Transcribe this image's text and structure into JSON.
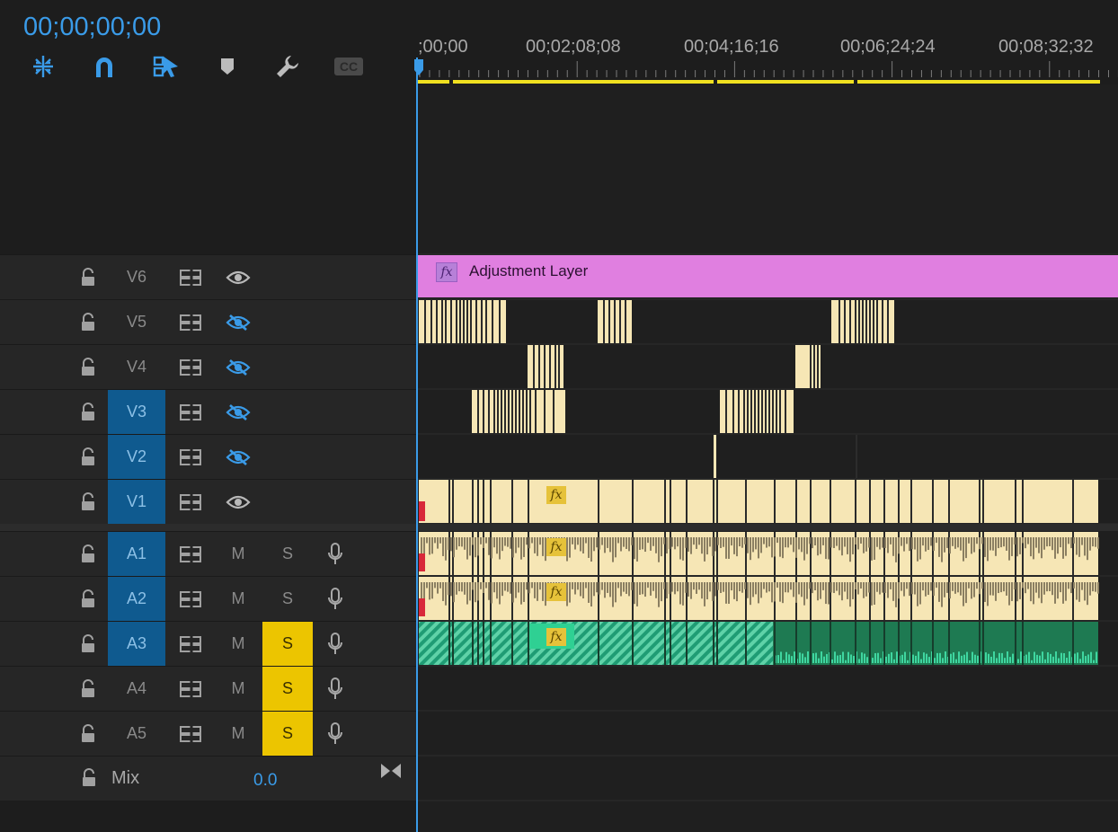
{
  "timecode": "00;00;00;00",
  "toolbar": {
    "tools": [
      "nest-sequence",
      "snap",
      "linked-selection",
      "add-marker",
      "timeline-settings",
      "captions"
    ],
    "captions_label": "CC"
  },
  "ruler": {
    "labels": [
      ";00;00",
      "00;02;08;08",
      "00;04;16;16",
      "00;06;24;24",
      "00;08;32;32"
    ]
  },
  "video_tracks": [
    {
      "name": "V6",
      "targeted": false,
      "visible": true
    },
    {
      "name": "V5",
      "targeted": false,
      "visible": false
    },
    {
      "name": "V4",
      "targeted": false,
      "visible": false
    },
    {
      "name": "V3",
      "targeted": true,
      "visible": false
    },
    {
      "name": "V2",
      "targeted": true,
      "visible": false
    },
    {
      "name": "V1",
      "targeted": true,
      "visible": true
    }
  ],
  "audio_tracks": [
    {
      "name": "A1",
      "targeted": true,
      "mute": "M",
      "solo": "S",
      "solo_on": false
    },
    {
      "name": "A2",
      "targeted": true,
      "mute": "M",
      "solo": "S",
      "solo_on": false
    },
    {
      "name": "A3",
      "targeted": true,
      "mute": "M",
      "solo": "S",
      "solo_on": true
    },
    {
      "name": "A4",
      "targeted": false,
      "mute": "M",
      "solo": "S",
      "solo_on": true
    },
    {
      "name": "A5",
      "targeted": false,
      "mute": "M",
      "solo": "S",
      "solo_on": true
    }
  ],
  "mix": {
    "label": "Mix",
    "value": "0.0"
  },
  "adjustment_layer": {
    "label": "Adjustment Layer",
    "fx": "fx"
  },
  "fx_label": "fx",
  "colors": {
    "accent": "#3a9be8",
    "adjustment": "#e07fe0",
    "video_clip": "#f6e6b5",
    "audio_clip_a3": "#1e7a52",
    "solo": "#ecc500",
    "target": "#0f5a8f",
    "work_area": "#f0e020"
  }
}
